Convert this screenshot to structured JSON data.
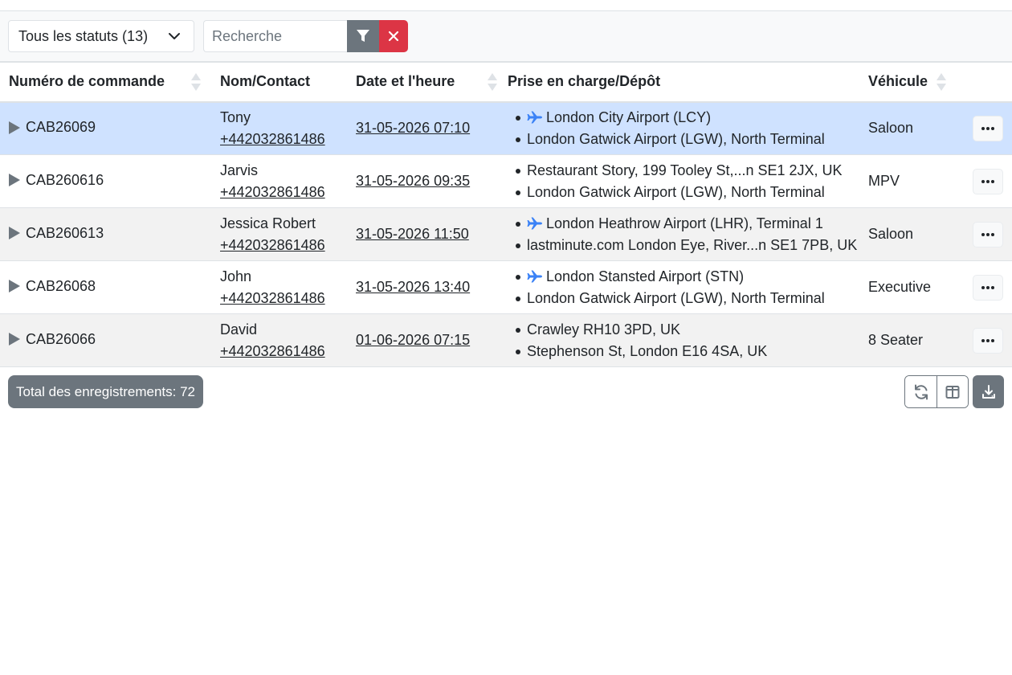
{
  "colors": {
    "accent_plane": "#3b82f6",
    "selected_row": "#cfe2ff",
    "clear_button": "#dc3545",
    "secondary": "#6c757d"
  },
  "toolbar": {
    "status_filter": "Tous les statuts (13)",
    "search_placeholder": "Recherche",
    "search_value": "",
    "filter_icon": "funnel-icon",
    "clear_icon": "close-icon"
  },
  "table": {
    "columns": [
      {
        "label": "Numéro de commande",
        "sortable": true
      },
      {
        "label": "Nom/Contact",
        "sortable": false
      },
      {
        "label": "Date et l'heure",
        "sortable": true
      },
      {
        "label": "Prise en charge/Dépôt",
        "sortable": false
      },
      {
        "label": "Véhicule",
        "sortable": true
      }
    ],
    "rows": [
      {
        "order": "CAB26069",
        "name": "Tony",
        "phone": "+442032861486",
        "datetime": "31-05-2026 07:10",
        "pickup": "London City Airport (LCY)",
        "pickup_airport": true,
        "dropoff": "London Gatwick Airport (LGW), North Terminal",
        "vehicle": "Saloon"
      },
      {
        "order": "CAB260616",
        "name": "Jarvis",
        "phone": "+442032861486",
        "datetime": "31-05-2026 09:35",
        "pickup": "Restaurant Story, 199 Tooley St,...n SE1 2JX, UK",
        "pickup_airport": false,
        "dropoff": "London Gatwick Airport (LGW), North Terminal",
        "vehicle": "MPV"
      },
      {
        "order": "CAB260613",
        "name": "Jessica Robert",
        "phone": "+442032861486",
        "datetime": "31-05-2026 11:50",
        "pickup": "London Heathrow Airport (LHR), Terminal 1",
        "pickup_airport": true,
        "dropoff": "lastminute.com London Eye, River...n SE1 7PB, UK",
        "vehicle": "Saloon"
      },
      {
        "order": "CAB26068",
        "name": "John",
        "phone": "+442032861486",
        "datetime": "31-05-2026 13:40",
        "pickup": "London Stansted Airport (STN)",
        "pickup_airport": true,
        "dropoff": "London Gatwick Airport (LGW), North Terminal",
        "vehicle": "Executive"
      },
      {
        "order": "CAB26066",
        "name": "David",
        "phone": "+442032861486",
        "datetime": "01-06-2026 07:15",
        "pickup": "Crawley RH10 3PD, UK",
        "pickup_airport": false,
        "dropoff": "Stephenson St, London E16 4SA, UK",
        "vehicle": "8 Seater"
      }
    ],
    "selected_row_index": 0
  },
  "footer": {
    "total_label": "Total des enregistrements: 72",
    "tools": [
      "refresh-icon",
      "columns-icon",
      "download-icon"
    ]
  }
}
